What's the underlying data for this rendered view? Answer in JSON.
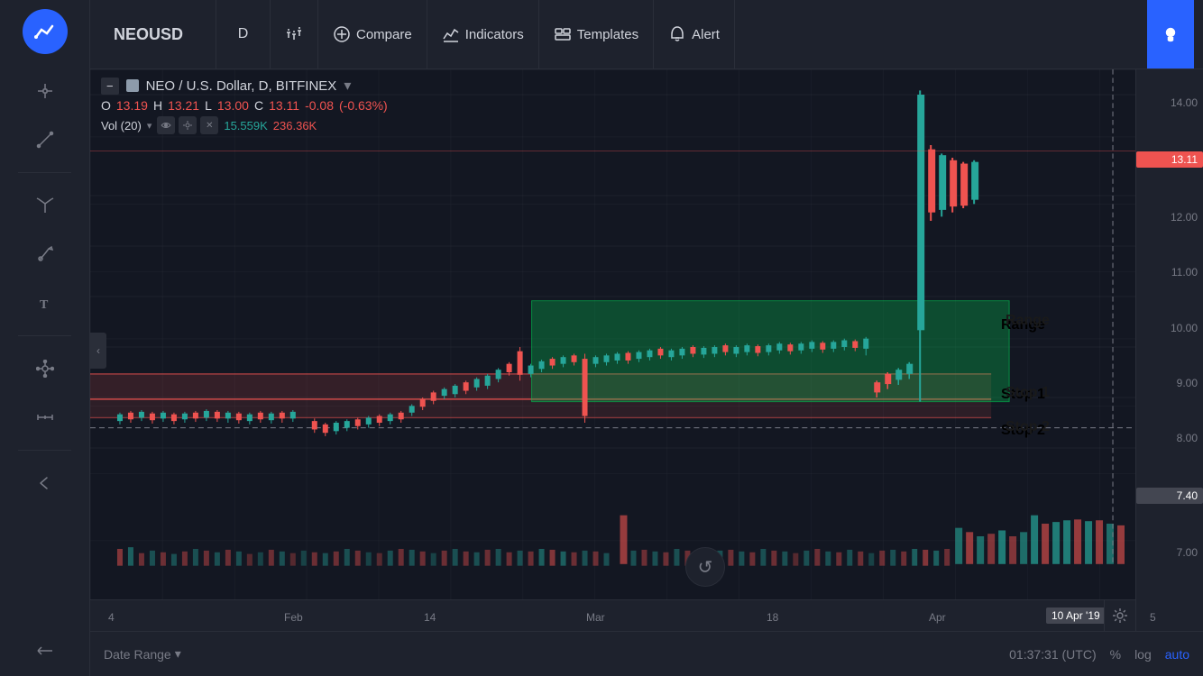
{
  "toolbar": {
    "logo_alt": "TradingView Logo",
    "tools": [
      {
        "name": "crosshair",
        "label": "Crosshair"
      },
      {
        "name": "line",
        "label": "Line Tool"
      },
      {
        "name": "fork",
        "label": "Pitchfork"
      },
      {
        "name": "brush",
        "label": "Brush"
      },
      {
        "name": "text",
        "label": "Text"
      },
      {
        "name": "node",
        "label": "Node"
      },
      {
        "name": "measure",
        "label": "Measure"
      },
      {
        "name": "back",
        "label": "Back"
      }
    ]
  },
  "header": {
    "symbol": "NEOUSD",
    "timeframe": "D",
    "compare_label": "Compare",
    "indicators_label": "Indicators",
    "templates_label": "Templates",
    "alert_label": "Alert"
  },
  "chart": {
    "title": "NEO / U.S. Dollar, D, BITFINEX",
    "ohlc": {
      "open_label": "O",
      "open_value": "13.19",
      "high_label": "H",
      "high_value": "13.21",
      "low_label": "L",
      "low_value": "13.00",
      "close_label": "C",
      "close_value": "13.11",
      "change": "-0.08",
      "change_pct": "(-0.63%)"
    },
    "volume": {
      "label": "Vol (20)",
      "val1": "15.559K",
      "val2": "236.36K"
    },
    "price_labels": [
      "14.00",
      "13.11",
      "12.00",
      "11.00",
      "10.00",
      "9.00",
      "8.00",
      "7.40",
      "7.00"
    ],
    "current_price": "13.11",
    "dashed_price": "7.40",
    "time_labels": [
      "4",
      "Feb",
      "14",
      "Mar",
      "18",
      "Apr"
    ],
    "active_date": "10 Apr '19",
    "annotations": {
      "range_label": "Range",
      "stop1_label": "Stop 1",
      "stop2_label": "Stop 2"
    }
  },
  "bottom_bar": {
    "date_range_label": "Date Range",
    "time": "01:37:31 (UTC)",
    "percent_label": "%",
    "log_label": "log",
    "auto_label": "auto"
  }
}
